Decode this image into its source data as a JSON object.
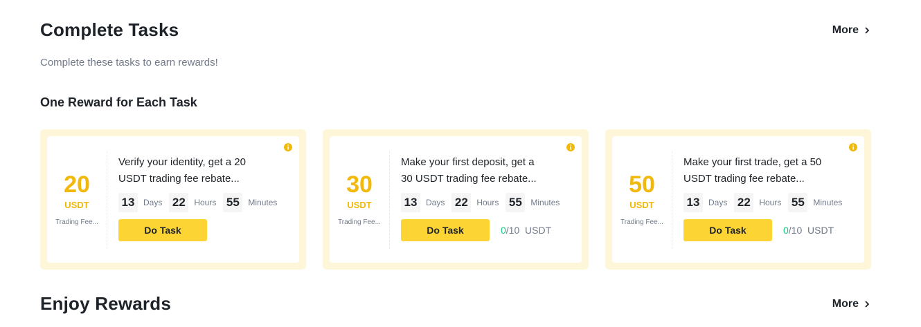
{
  "complete_tasks": {
    "title": "Complete Tasks",
    "more_label": "More",
    "subtitle": "Complete these tasks to earn rewards!",
    "group_title": "One Reward for Each Task"
  },
  "cards": [
    {
      "amount": "20",
      "unit": "USDT",
      "type": "Trading Fee...",
      "description": "Verify your identity, get a 20 USDT trading fee rebate...",
      "days": "13",
      "days_label": "Days",
      "hours": "22",
      "hours_label": "Hours",
      "minutes": "55",
      "minutes_label": "Minutes",
      "button_label": "Do Task"
    },
    {
      "amount": "30",
      "unit": "USDT",
      "type": "Trading Fee...",
      "description": "Make your first deposit, get a 30 USDT trading fee rebate...",
      "days": "13",
      "days_label": "Days",
      "hours": "22",
      "hours_label": "Hours",
      "minutes": "55",
      "minutes_label": "Minutes",
      "button_label": "Do Task",
      "progress_current": "0",
      "progress_total": "/10",
      "progress_unit": "USDT"
    },
    {
      "amount": "50",
      "unit": "USDT",
      "type": "Trading Fee...",
      "description": "Make your first trade, get a 50 USDT trading fee rebate...",
      "days": "13",
      "days_label": "Days",
      "hours": "22",
      "hours_label": "Hours",
      "minutes": "55",
      "minutes_label": "Minutes",
      "button_label": "Do Task",
      "progress_current": "0",
      "progress_total": "/10",
      "progress_unit": "USDT"
    }
  ],
  "enjoy_rewards": {
    "title": "Enjoy Rewards",
    "more_label": "More"
  },
  "colors": {
    "accent": "#fcd535",
    "reward": "#f0b90b",
    "card_bg": "#fef6d8",
    "progress_current": "#0ecb81"
  },
  "icons": {
    "more": "chevron-right-icon",
    "info": "info-icon"
  }
}
